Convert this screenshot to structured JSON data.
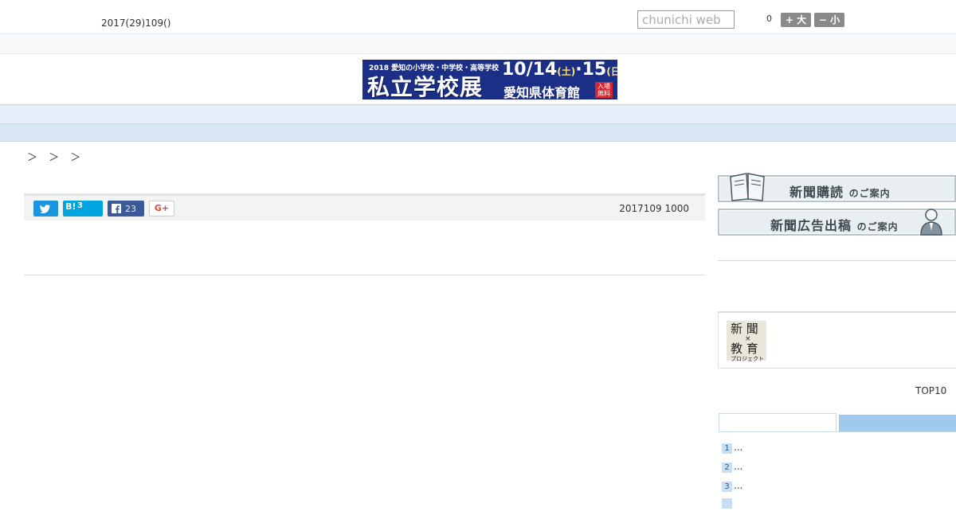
{
  "header": {
    "date": "2017(29)109()",
    "search_placeholder": "chunichi web",
    "font_count": "0",
    "font_bigger": "+ 大",
    "font_smaller": "− 小"
  },
  "banner": {
    "top_line": "2018 愛知の小学校・中学校・高等学校",
    "main_text": "私立学校展",
    "date_text": "10/14",
    "date_day1": "(土)",
    "date_text2": "·15",
    "date_day2": "(日)",
    "place": "愛知県体育館",
    "free": "入場無料"
  },
  "nav": {
    "items": [
      "",
      "",
      "",
      "",
      "",
      "",
      "",
      "",
      ""
    ]
  },
  "breadcrumb": "＞ ＞ ＞",
  "share": {
    "twitter_icon": "twitter-bird-icon",
    "hatena_label": "B!",
    "hatena_count": "3",
    "facebook_count": "23",
    "gplus_label": "G+"
  },
  "article": {
    "published": "2017109 1000"
  },
  "sidebar": {
    "subscribe_banner": "新聞購読",
    "subscribe_suffix": "のご案内",
    "ad_banner": "新聞広告出稿",
    "ad_suffix": "のご案内",
    "edu_logo_line1": "新 聞",
    "edu_logo_x": "×",
    "edu_logo_line2": "教 育",
    "edu_logo_sub": "プロジェクト",
    "ranking_title": "TOP10",
    "ranking": [
      {
        "rank": "1",
        "text": "..."
      },
      {
        "rank": "2",
        "text": "..."
      },
      {
        "rank": "3",
        "text": "..."
      }
    ]
  },
  "colors": {
    "nav_bg": "#e7f0fa",
    "tab_active": "#9ecbed",
    "banner_bg": "#1b2f86"
  }
}
